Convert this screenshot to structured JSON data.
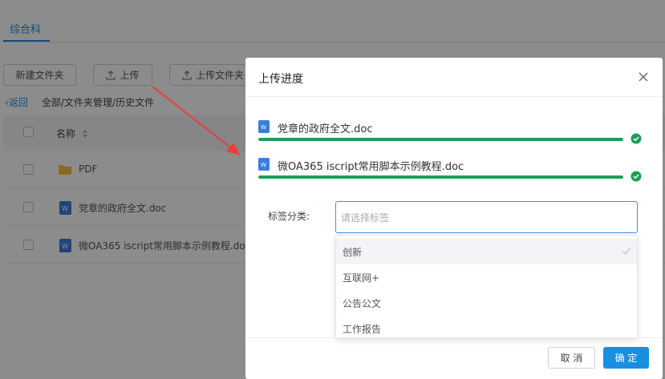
{
  "page": {
    "tab_label": "综合科",
    "toolbar": {
      "new_folder": "新建文件夹",
      "upload": "上传",
      "upload_folder": "上传文件夹"
    },
    "back_label": "返回",
    "breadcrumb": "全部/文件夹管理/历史文件",
    "table": {
      "header_name": "名称",
      "rows": [
        {
          "name": "PDF",
          "icon": "folder-icon"
        },
        {
          "name": "党章的政府全文.doc",
          "icon": "word-doc-icon"
        },
        {
          "name": "微OA365 iscript常用脚本示例教程.doc",
          "icon": "word-doc-icon"
        }
      ]
    }
  },
  "modal": {
    "title": "上传进度",
    "files": [
      {
        "name": "党章的政府全文.doc",
        "progress": 1.0,
        "status": "complete"
      },
      {
        "name": "微OA365 iscript常用脚本示例教程.doc",
        "progress": 1.0,
        "status": "complete"
      }
    ],
    "tag_label": "标签分类:",
    "tag_select": {
      "placeholder": "请选择标签",
      "value": "",
      "options": [
        {
          "label": "创新",
          "selected": true
        },
        {
          "label": "互联网+",
          "selected": false
        },
        {
          "label": "公告公文",
          "selected": false
        },
        {
          "label": "工作报告",
          "selected": false
        }
      ]
    },
    "cancel_label": "取 消",
    "ok_label": "确 定"
  },
  "colors": {
    "accent": "#1a8fe0",
    "progress": "#18a058",
    "annotation_arrow": "#e8403a"
  }
}
